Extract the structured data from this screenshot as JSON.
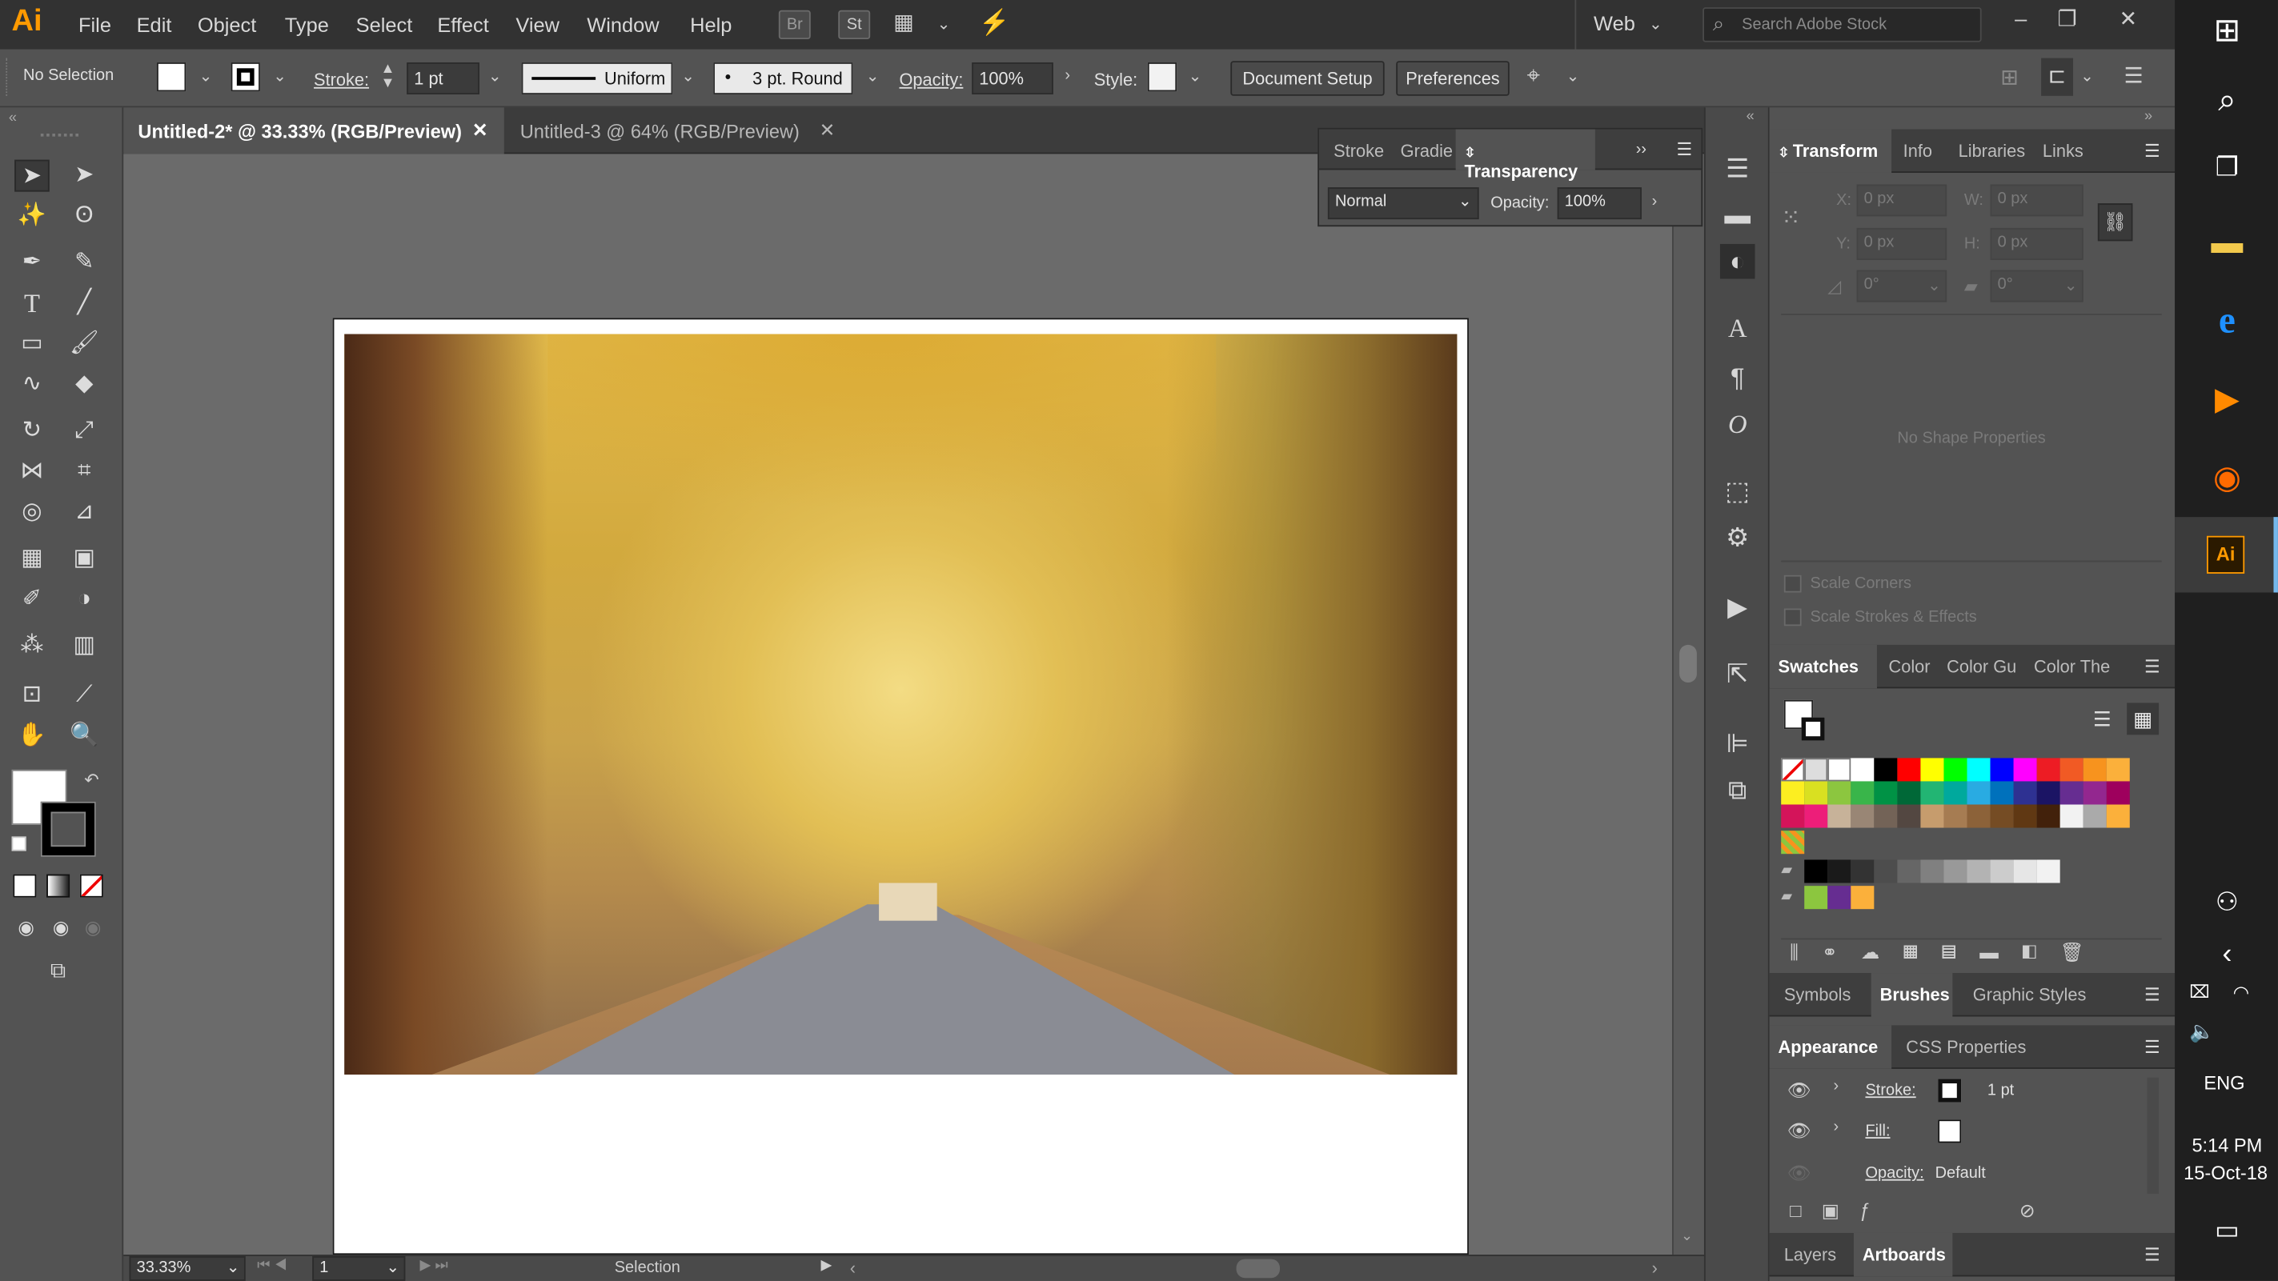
{
  "menubar": {
    "logo": "Ai",
    "menus": [
      "File",
      "Edit",
      "Object",
      "Type",
      "Select",
      "Effect",
      "View",
      "Window",
      "Help"
    ],
    "bridge_label": "Br",
    "stock_label": "St",
    "workspace": "Web",
    "search_placeholder": "Search Adobe Stock"
  },
  "control": {
    "selection": "No Selection",
    "stroke_label": "Stroke:",
    "stroke_value": "1 pt",
    "profile": "Uniform",
    "brush": "3 pt. Round",
    "opacity_label": "Opacity:",
    "opacity_value": "100%",
    "style_label": "Style:",
    "document_setup": "Document Setup",
    "preferences": "Preferences"
  },
  "tabs": [
    {
      "label": "Untitled-2* @ 33.33% (RGB/Preview)",
      "active": true
    },
    {
      "label": "Untitled-3 @ 64% (RGB/Preview)",
      "active": false
    }
  ],
  "transparency_panel": {
    "tabs": [
      "Stroke",
      "Gradie",
      "Transparency"
    ],
    "blend_mode": "Normal",
    "opacity_label": "Opacity:",
    "opacity_value": "100%"
  },
  "transform_panel": {
    "tabs": [
      "Transform",
      "Info",
      "Libraries",
      "Links"
    ],
    "x_label": "X:",
    "x_value": "0 px",
    "y_label": "Y:",
    "y_value": "0 px",
    "w_label": "W:",
    "w_value": "0 px",
    "h_label": "H:",
    "h_value": "0 px",
    "rotate_value": "0°",
    "shear_value": "0°",
    "empty_message": "No Shape Properties",
    "scale_corners": "Scale Corners",
    "scale_strokes": "Scale Strokes & Effects"
  },
  "swatches_panel": {
    "tabs": [
      "Swatches",
      "Color",
      "Color Gu",
      "Color The"
    ],
    "row1": [
      "#ffffff",
      "#000000",
      "#ff0000",
      "#ffff00",
      "#00ff00",
      "#00ffff",
      "#0000ff",
      "#ff00ff",
      "#ed1c24",
      "#f15a24",
      "#f7931e",
      "#fbb03b"
    ],
    "row2": [
      "#fcee21",
      "#d9e021",
      "#8cc63f",
      "#39b54a",
      "#009245",
      "#006837",
      "#22b573",
      "#00a99d",
      "#29abe2",
      "#0071bc",
      "#2e3192",
      "#1b1464",
      "#662d91",
      "#93278f",
      "#9e005d"
    ],
    "row3": [
      "#d4145a",
      "#ed1e79",
      "#c7b299",
      "#998675",
      "#736357",
      "#534741",
      "#c69c6d",
      "#a67c52",
      "#8c6239",
      "#754c24",
      "#603813",
      "#42210b",
      "#f2f2f2",
      "#aaaaaa",
      "#fbb03b"
    ],
    "grays": [
      "#000000",
      "#1a1a1a",
      "#333333",
      "#4d4d4d",
      "#666666",
      "#808080",
      "#999999",
      "#b3b3b3",
      "#cccccc",
      "#e6e6e6",
      "#f2f2f2"
    ],
    "extra": [
      "#8cc63f",
      "#662d91",
      "#fbb03b"
    ]
  },
  "lower_tabs1": [
    "Symbols",
    "Brushes",
    "Graphic Styles"
  ],
  "appearance_panel": {
    "tabs": [
      "Appearance",
      "CSS Properties"
    ],
    "stroke_label": "Stroke:",
    "stroke_value": "1 pt",
    "fill_label": "Fill:",
    "opacity_label": "Opacity:",
    "opacity_value": "Default"
  },
  "lower_tabs2": [
    "Layers",
    "Artboards"
  ],
  "statusbar": {
    "zoom": "33.33%",
    "artboard_number": "1",
    "tool_name": "Selection"
  },
  "taskbar": {
    "language": "ENG",
    "time": "5:14 PM",
    "date": "15-Oct-18"
  }
}
